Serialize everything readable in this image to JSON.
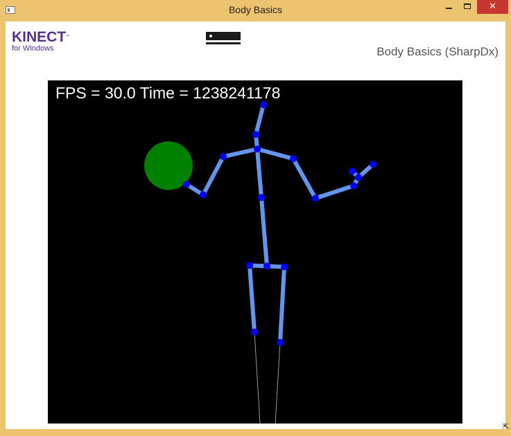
{
  "window": {
    "title": "Body Basics",
    "close_glyph": "✕"
  },
  "header": {
    "logo_brand": "KINECT",
    "logo_tm": "™",
    "logo_sub": "for Windows",
    "sensor_icon": "kinect-sensor-icon",
    "app_title": "Body Basics (SharpDx)"
  },
  "viewport": {
    "fps_label": "FPS = 30.0 Time = 1238241178",
    "bone_color": "#6495ed",
    "joint_color": "#0000ff",
    "hand_closed_color": "#008000",
    "inferred_bone_color": "#999999"
  }
}
